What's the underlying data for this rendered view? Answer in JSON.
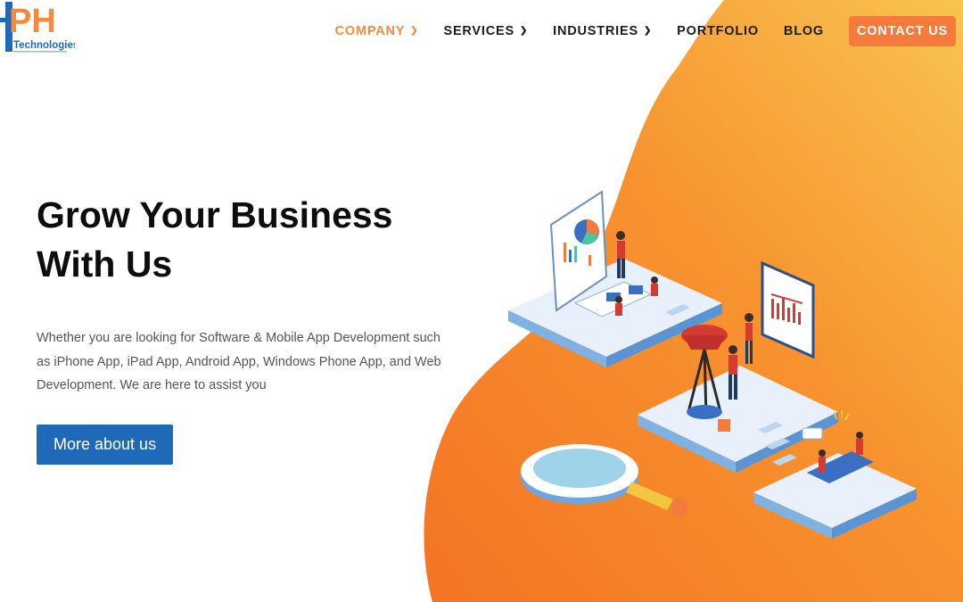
{
  "brand": {
    "logo_text": "PH",
    "logo_sub": "Technologies",
    "accent": "#f58a3c",
    "blue": "#1f6ab8"
  },
  "nav": {
    "items": [
      {
        "label": "COMPANY",
        "dropdown": true,
        "active": true
      },
      {
        "label": "SERVICES",
        "dropdown": true,
        "active": false
      },
      {
        "label": "INDUSTRIES",
        "dropdown": true,
        "active": false
      },
      {
        "label": "PORTFOLIO",
        "dropdown": false,
        "active": false
      },
      {
        "label": "BLOG",
        "dropdown": false,
        "active": false
      }
    ],
    "chevron_icon": "chevron-down-icon",
    "contact_label": "CONTACT US"
  },
  "hero": {
    "title_line1": "Grow Your Business",
    "title_line2": "With Us",
    "description": "Whether you are looking for Software & Mobile App Development such as iPhone App, iPad App, Android App, Windows Phone App, and Web Development. We are here to assist you",
    "button_label": "More about us"
  },
  "illustration": {
    "name": "isometric-business-team-illustration",
    "blob_colors": [
      "#f9c450",
      "#f7932f",
      "#f47424"
    ]
  }
}
